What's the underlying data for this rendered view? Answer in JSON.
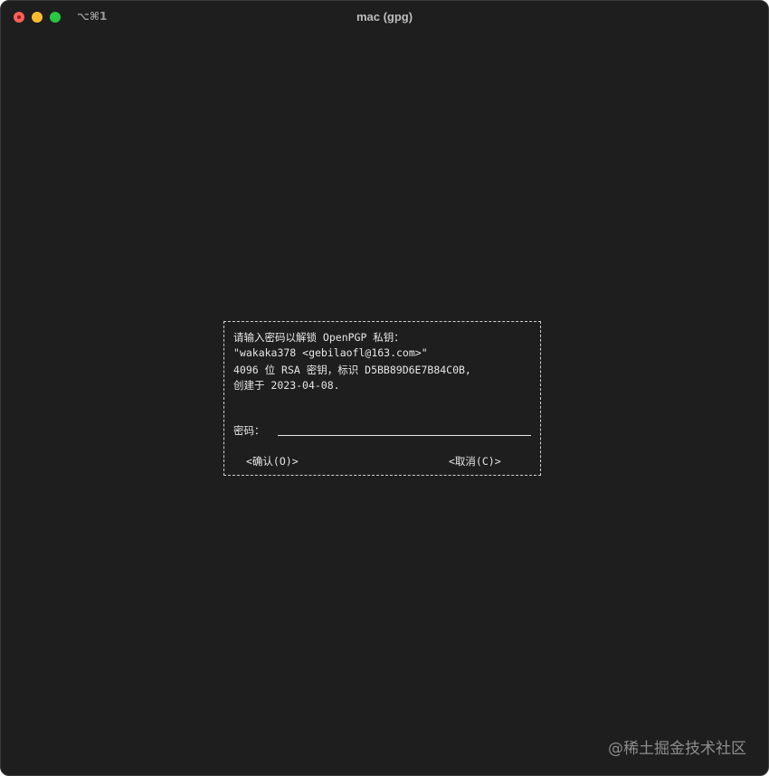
{
  "window": {
    "shortcut": "⌥⌘1",
    "title": "mac (gpg)"
  },
  "dialog": {
    "message_lines": [
      "请输入密码以解锁 OpenPGP 私钥：",
      "\"wakaka378 <gebilaofl@163.com>\"",
      "4096 位 RSA 密钥，标识 D5BB89D6E7B84C0B,",
      "创建于 2023-04-08."
    ],
    "password_label": "密码：",
    "password_value": "",
    "ok_label": "<确认(O)>",
    "cancel_label": "<取消(C)>"
  },
  "watermark": "@稀土掘金技术社区"
}
